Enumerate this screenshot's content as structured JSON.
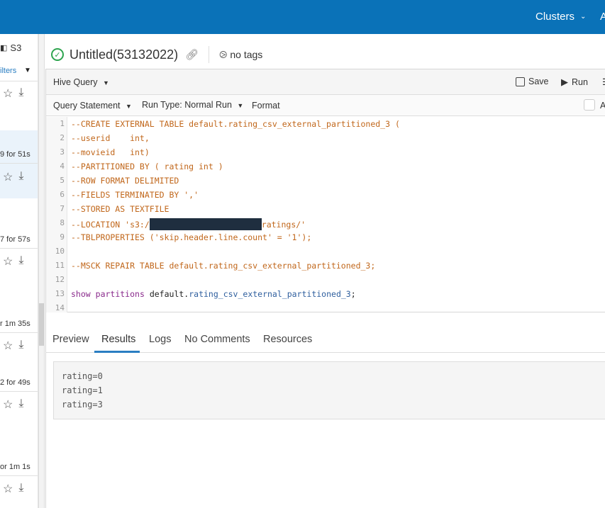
{
  "topbar": {
    "clusters_label": "Clusters",
    "cut_label": "A"
  },
  "sidebar": {
    "s3_label": "S3",
    "filters_label": "ilters",
    "durations": [
      "9 for 51s",
      "7 for 57s",
      "r 1m 35s",
      "2 for 49s",
      "or 1m 1s"
    ]
  },
  "title": {
    "name": "Untitled(53132022)",
    "tags": "no tags"
  },
  "toolbar": {
    "hive_query": "Hive Query",
    "save": "Save",
    "run": "Run",
    "query_statement": "Query Statement",
    "run_type": "Run Type: Normal Run",
    "format": "Format",
    "cut_label": "A"
  },
  "editor": {
    "line_numbers": [
      "1",
      "2",
      "3",
      "4",
      "5",
      "6",
      "7",
      "8",
      "9",
      "10",
      "11",
      "12",
      "13",
      "14"
    ],
    "lines": [
      "--CREATE EXTERNAL TABLE default.rating_csv_external_partitioned_3 (",
      "--userid    int,",
      "--movieid   int)",
      "--PARTITIONED BY ( rating int )",
      "--ROW FORMAT DELIMITED",
      "--FIELDS TERMINATED BY ','",
      "--STORED AS TEXTFILE",
      "--LOCATION 's3:/",
      "--TBLPROPERTIES ('skip.header.line.count' = '1');",
      "",
      "--MSCK REPAIR TABLE default.rating_csv_external_partitioned_3;",
      "",
      "",
      ""
    ],
    "line8_suffix": "ratings/'",
    "line13": {
      "kw1": "show",
      "kw2": "partitions",
      "db": "default",
      "dot": ".",
      "table": "rating_csv_external_partitioned_3",
      "end": ";"
    }
  },
  "tabs": [
    "Preview",
    "Results",
    "Logs",
    "No Comments",
    "Resources"
  ],
  "results": [
    "rating=0",
    "rating=1",
    "rating=3"
  ]
}
